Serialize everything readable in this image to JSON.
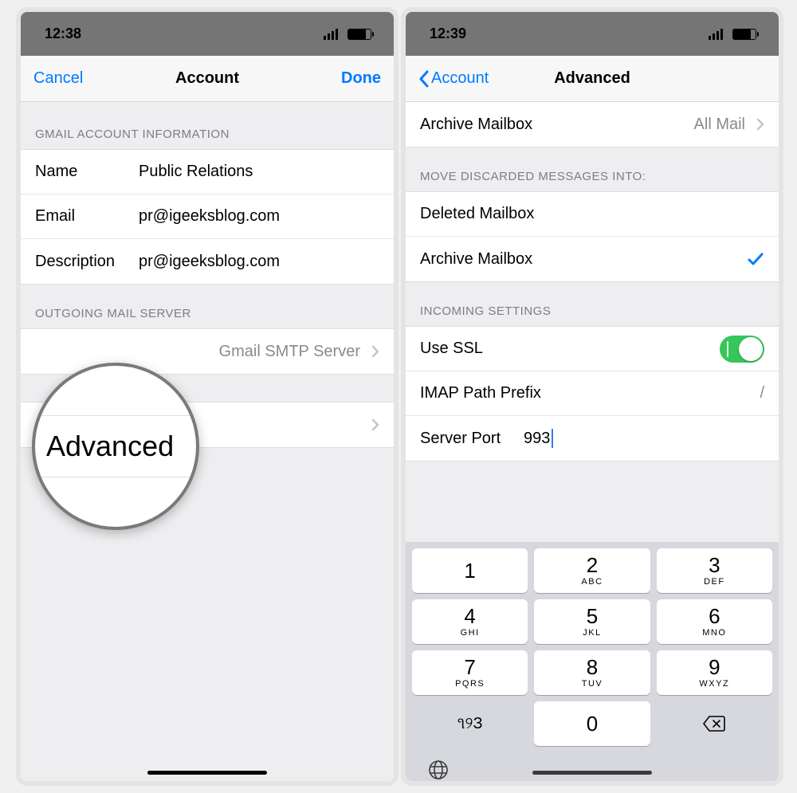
{
  "left": {
    "status": {
      "time": "12:38"
    },
    "nav": {
      "cancel": "Cancel",
      "title": "Account",
      "done": "Done"
    },
    "section1_header": "GMAIL ACCOUNT INFORMATION",
    "fields": {
      "name_label": "Name",
      "name_value": "Public Relations",
      "email_label": "Email",
      "email_value": "pr@igeeksblog.com",
      "desc_label": "Description",
      "desc_value": "pr@igeeksblog.com"
    },
    "section2_header": "OUTGOING MAIL SERVER",
    "smtp_value": "Gmail SMTP Server",
    "magnified": "Advanced"
  },
  "right": {
    "status": {
      "time": "12:39"
    },
    "nav": {
      "back": "Account",
      "title": "Advanced"
    },
    "archive_row": {
      "label": "Archive Mailbox",
      "value": "All Mail"
    },
    "discard_header": "MOVE DISCARDED MESSAGES INTO:",
    "discard_opts": {
      "deleted": "Deleted Mailbox",
      "archive": "Archive Mailbox"
    },
    "incoming_header": "INCOMING SETTINGS",
    "ssl_label": "Use SSL",
    "ssl_on": true,
    "prefix_label": "IMAP Path Prefix",
    "prefix_value": "/",
    "port_label": "Server Port",
    "port_value": "993",
    "keypad": {
      "keys": [
        {
          "n": "1",
          "l": ""
        },
        {
          "n": "2",
          "l": "ABC"
        },
        {
          "n": "3",
          "l": "DEF"
        },
        {
          "n": "4",
          "l": "GHI"
        },
        {
          "n": "5",
          "l": "JKL"
        },
        {
          "n": "6",
          "l": "MNO"
        },
        {
          "n": "7",
          "l": "PQRS"
        },
        {
          "n": "8",
          "l": "TUV"
        },
        {
          "n": "9",
          "l": "WXYZ"
        }
      ],
      "alt": "૧୨З",
      "zero": "0"
    }
  }
}
